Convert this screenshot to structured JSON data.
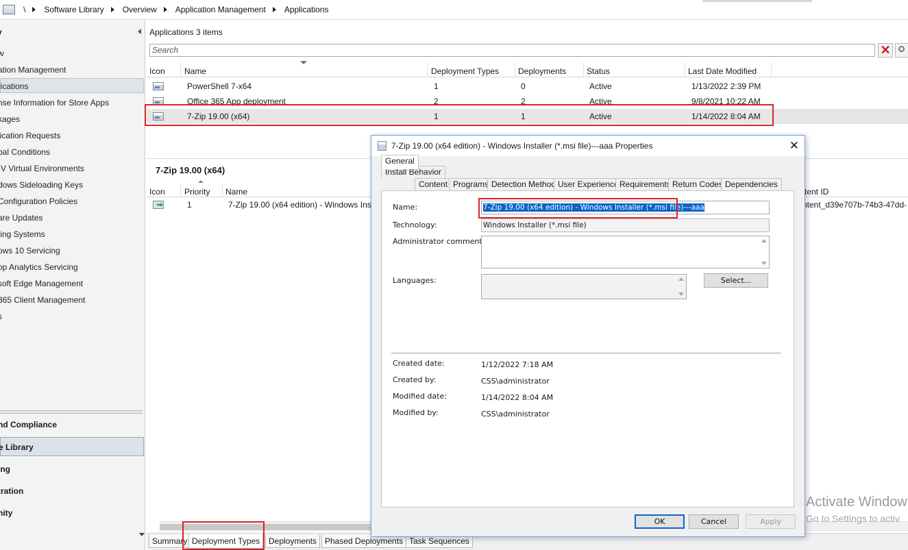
{
  "breadcrumb": {
    "root": "\\",
    "items": [
      "Software Library",
      "Overview",
      "Application Management",
      "Applications"
    ]
  },
  "nav": {
    "header": "y",
    "items": [
      {
        "label": "w"
      },
      {
        "label": "ation Management"
      },
      {
        "label": "lications"
      },
      {
        "label": "nse Information for Store Apps"
      },
      {
        "label": "kages"
      },
      {
        "label": "lication Requests"
      },
      {
        "label": "bal Conditions"
      },
      {
        "label": "-V Virtual Environments"
      },
      {
        "label": "dows Sideloading Keys"
      },
      {
        "label": " Configuration Policies"
      },
      {
        "label": "are Updates"
      },
      {
        "label": "ting Systems"
      },
      {
        "label": "ows 10 Servicing"
      },
      {
        "label": "op Analytics Servicing"
      },
      {
        "label": "soft Edge Management"
      },
      {
        "label": " 365 Client Management"
      },
      {
        "label": "s"
      }
    ],
    "workspaces": [
      {
        "label": "nd Compliance"
      },
      {
        "label": "e Library"
      },
      {
        "label": "ing"
      },
      {
        "label": "tration"
      },
      {
        "label": "nity"
      }
    ]
  },
  "list": {
    "title": "Applications 3 items",
    "search_placeholder": "Search",
    "columns": [
      "Icon",
      "Name",
      "Deployment Types",
      "Deployments",
      "Status",
      "Last Date Modified"
    ],
    "rows": [
      {
        "name": "PowerShell 7-x64",
        "deployment_types": "1",
        "deployments": "0",
        "status": "Active",
        "modified": "1/13/2022 2:39 PM"
      },
      {
        "name": "Office 365 App deployment",
        "deployment_types": "2",
        "deployments": "2",
        "status": "Active",
        "modified": "9/8/2021 10:22 AM"
      },
      {
        "name": "7-Zip 19.00 (x64)",
        "deployment_types": "1",
        "deployments": "1",
        "status": "Active",
        "modified": "1/14/2022 8:04 AM"
      }
    ]
  },
  "detail": {
    "title": "7-Zip 19.00 (x64)",
    "columns": [
      "Icon",
      "Priority",
      "Name",
      "tent ID"
    ],
    "rows": [
      {
        "priority": "1",
        "name": "7-Zip 19.00 (x64 edition) - Windows Ins",
        "content_id": "ntent_d39e707b-74b3-47dd-"
      }
    ]
  },
  "bottom_tabs": [
    "Summary",
    "Deployment Types",
    "Deployments",
    "Phased Deployments",
    "Task Sequences"
  ],
  "dialog": {
    "title": "7-Zip 19.00 (x64 edition) - Windows Installer (*.msi file)---aaa Properties",
    "tabs_row1": [
      "Install Behavior"
    ],
    "tabs_row2": [
      "General",
      "Content",
      "Programs",
      "Detection Method",
      "User Experience",
      "Requirements",
      "Return Codes",
      "Dependencies"
    ],
    "fields": {
      "name_label": "Name:",
      "name_value": "7-Zip 19.00 (x64 edition) - Windows Installer (*.msi file)---aaa",
      "technology_label": "Technology:",
      "technology_value": "Windows Installer (*.msi file)",
      "comments_label": "Administrator comments:",
      "languages_label": "Languages:",
      "select_button": "Select..."
    },
    "info": {
      "created_date_label": "Created date:",
      "created_date": "1/12/2022 7:18 AM",
      "created_by_label": "Created by:",
      "created_by": "CSS\\administrator",
      "modified_date_label": "Modified date:",
      "modified_date": "1/14/2022 8:04 AM",
      "modified_by_label": "Modified by:",
      "modified_by": "CSS\\administrator"
    },
    "buttons": {
      "ok": "OK",
      "cancel": "Cancel",
      "apply": "Apply"
    }
  },
  "watermark": {
    "line1": "Activate Window",
    "line2": "Go to Settings to activ"
  },
  "colors": {
    "annotation": "#d9242a",
    "accent": "#0a64c8"
  }
}
